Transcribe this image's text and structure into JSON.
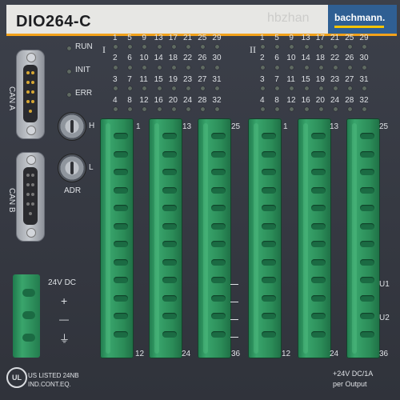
{
  "header": {
    "model": "DIO264-C",
    "brand": "bachmann.",
    "watermark": "hbzhan",
    "brand_color": "#2f5f93",
    "accent_color": "#f2a21b"
  },
  "status_leds": [
    "RUN",
    "INIT",
    "ERR"
  ],
  "can_ports": [
    "CAN A",
    "CAN B"
  ],
  "rotary": {
    "labels": [
      "H",
      "L"
    ],
    "address_label": "ADR"
  },
  "groups": [
    {
      "roman": "I",
      "rows": [
        [
          "1",
          "5",
          "9",
          "13",
          "17",
          "21",
          "25",
          "29"
        ],
        [
          "2",
          "6",
          "10",
          "14",
          "18",
          "22",
          "26",
          "30"
        ],
        [
          "3",
          "7",
          "11",
          "15",
          "19",
          "23",
          "27",
          "31"
        ],
        [
          "4",
          "8",
          "12",
          "16",
          "20",
          "24",
          "28",
          "32"
        ]
      ]
    },
    {
      "roman": "II",
      "rows": [
        [
          "1",
          "5",
          "9",
          "13",
          "17",
          "21",
          "25",
          "29"
        ],
        [
          "2",
          "6",
          "10",
          "14",
          "18",
          "22",
          "26",
          "30"
        ],
        [
          "3",
          "7",
          "11",
          "15",
          "19",
          "23",
          "27",
          "31"
        ],
        [
          "4",
          "8",
          "12",
          "16",
          "20",
          "24",
          "28",
          "32"
        ]
      ]
    }
  ],
  "connectors": [
    {
      "top": "1",
      "bottom": "12"
    },
    {
      "top": "13",
      "bottom": "24"
    },
    {
      "top": "25",
      "bottom": "36"
    },
    {
      "top": "1",
      "bottom": "12"
    },
    {
      "top": "13",
      "bottom": "24"
    },
    {
      "top": "25",
      "bottom": "36"
    }
  ],
  "terminal_markers": [
    "U1",
    "U2"
  ],
  "power": {
    "voltage": "24V DC",
    "plus": "+",
    "minus": "—",
    "ground": "⏚"
  },
  "certification": {
    "mark": "UL",
    "line1": "US LISTED 24NB",
    "line2": "IND.CONT.EQ."
  },
  "output_rating": {
    "line1": "+24V DC/1A",
    "line2": "per Output"
  },
  "connector_color": "#2b8c58"
}
